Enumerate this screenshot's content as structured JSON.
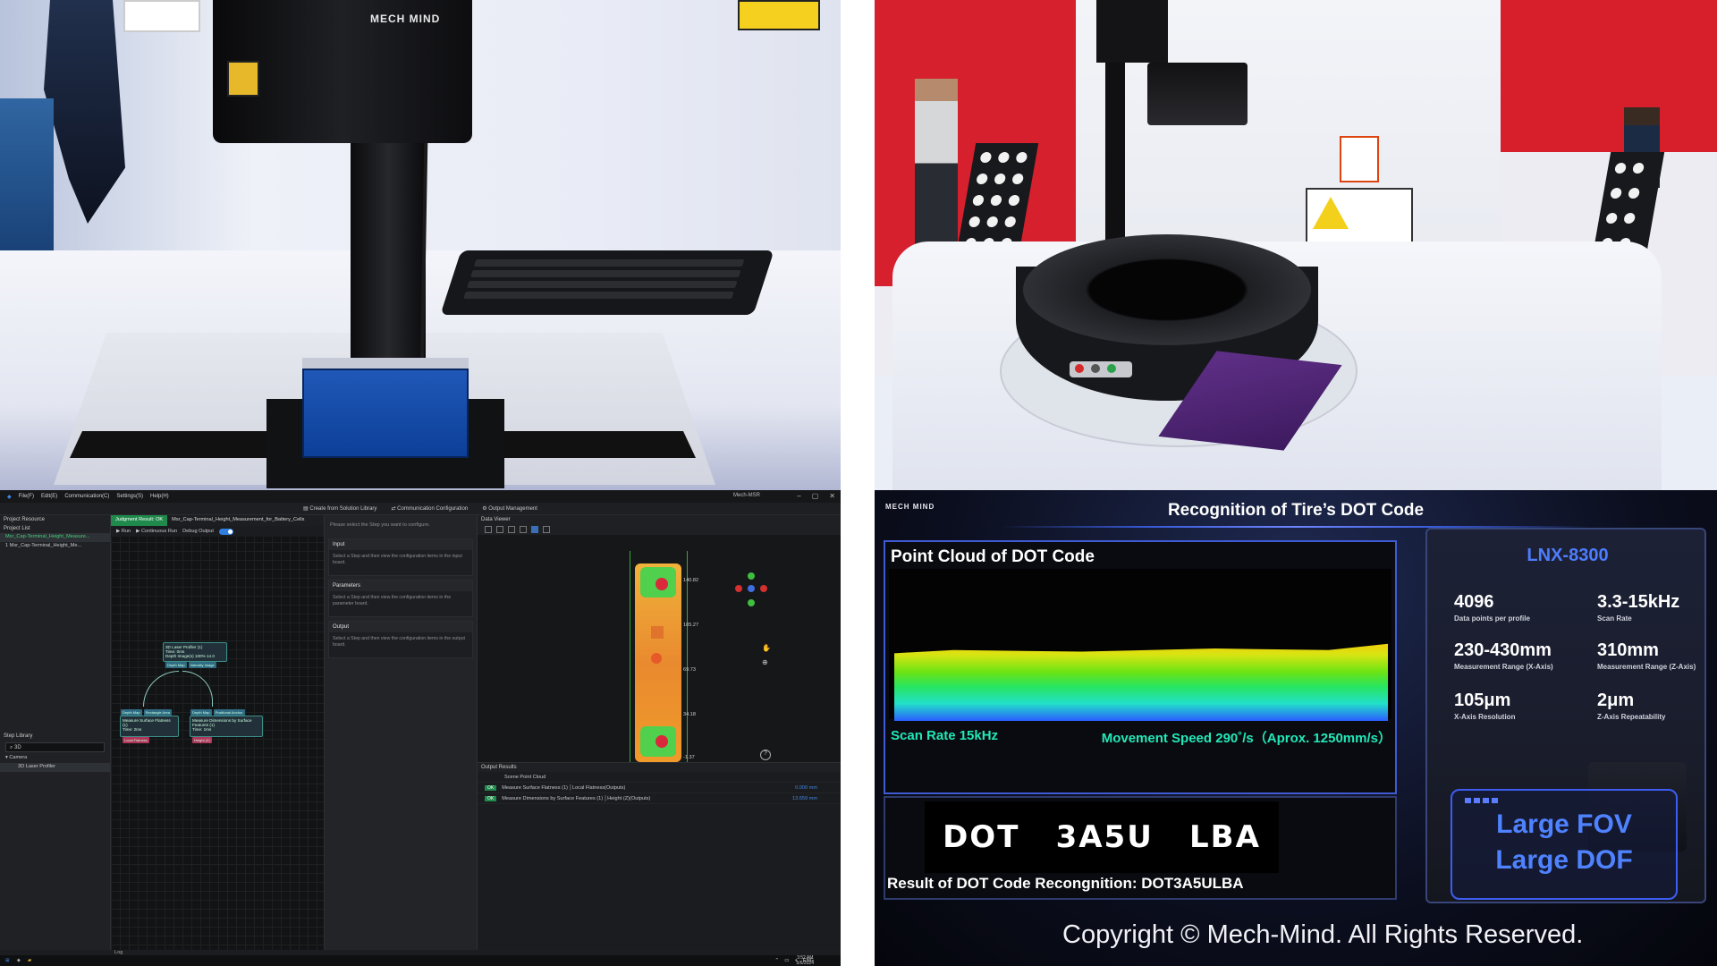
{
  "photo_left": {
    "brand": "MECH MIND"
  },
  "software": {
    "menu": [
      "File(F)",
      "Edit(E)",
      "Communication(C)",
      "Settings(S)",
      "Help(H)"
    ],
    "window_title": "Mech-MSR",
    "window_controls": [
      "–",
      "▢",
      "✕"
    ],
    "toolbar": [
      "Create from Solution Library",
      "Communication Configuration",
      "Output Management"
    ],
    "left_panel": {
      "project_resource": "Project Resource",
      "project_list": "Project List",
      "project_root": "Msr_Cap-Terminal_Height_Measure...",
      "project_child": "1  Msr_Cap-Terminal_Height_Me...",
      "step_library": "Step Library",
      "search_value": "3D",
      "category": "Camera",
      "step_item": "3D Laser Profiler"
    },
    "canvas": {
      "tab_result": "Judgment Result: OK",
      "tab_project": "Msr_Cap-Terminal_Height_Measurement_for_Battery_Cells",
      "run": "Run",
      "continuous_run": "Continuous Run",
      "debug_output": "Debug Output",
      "node_profiler": "3D Laser Profiler (1)",
      "node_profiler_sub": "Time: 0ms",
      "node_profiler_sub2": "Depth Image(s) 100% 14.0",
      "port_depth": "Depth Map",
      "port_intensity": "Intensity Image",
      "port_depth2": "Depth Map",
      "port_rect": "Rectangle Area",
      "port_depth3": "Depth Map",
      "port_feature": "Positional Anchor",
      "node_flatness": "Measure Surface Flatness (1)",
      "node_flatness_sub": "Time: 2ms",
      "node_dimension": "Measure Dimensions by Surface Features (1)",
      "node_dimension_sub": "Time: 1ms",
      "out_flatness": "Local Flatness",
      "out_height": "Height (Z)"
    },
    "config": {
      "hint": "Please select the Step you want to configure.",
      "sections": [
        {
          "title": "Input",
          "body": "Select a Step and then view the configuration items in the input board."
        },
        {
          "title": "Parameters",
          "body": "Select a Step and then view the configuration items in the parameter board."
        },
        {
          "title": "Output",
          "body": "Select a Step and then view the configuration items in the output board."
        }
      ]
    },
    "viewer": {
      "title": "Data Viewer",
      "y_ticks": [
        "140.82",
        "105.27",
        "69.73",
        "34.18",
        "-1.37"
      ],
      "help": "?"
    },
    "output_results": {
      "title": "Output Results",
      "scene": "Scene Point Cloud",
      "rows": [
        {
          "status": "OK",
          "label": "Measure Surface Flatness (1) │Local Flatness(Outputs)",
          "value": "0.000 mm"
        },
        {
          "status": "OK",
          "label": "Measure Dimensions by Surface Features (1) │Height (Z)(Outputs)",
          "value": "13.659 mm"
        }
      ]
    },
    "log": "Log",
    "taskbar": {
      "lang": "ENG",
      "time": "3:52 AM",
      "date": "5/6/2024"
    }
  },
  "slide": {
    "logo": "MECH MIND",
    "title": "Recognition of Tire’s DOT Code",
    "point_cloud_title": "Point Cloud of DOT Code",
    "scan_rate": "Scan Rate 15kHz",
    "movement_speed": "Movement Speed 290˚/s（Aprox. 1250mm/s）",
    "dot_tokens": [
      "DOT",
      "3A5U",
      "LBA"
    ],
    "result": "Result of DOT Code Recongnition: DOT3A5ULBA",
    "model": "LNX-8300",
    "specs": [
      {
        "value": "4096",
        "label": "Data points per profile"
      },
      {
        "value": "3.3-15kHz",
        "label": "Scan Rate"
      },
      {
        "value": "230-430mm",
        "label": "Measurement Range (X-Axis)"
      },
      {
        "value": "310mm",
        "label": "Measurement Range (Z-Axis)"
      },
      {
        "value": "105μm",
        "label": "X-Axis Resolution"
      },
      {
        "value": "2μm",
        "label": "Z-Axis Repeatability"
      }
    ],
    "badge_line1": "Large FOV",
    "badge_line2": "Large DOF",
    "copyright": "Copyright © Mech-Mind. All Rights Reserved."
  }
}
